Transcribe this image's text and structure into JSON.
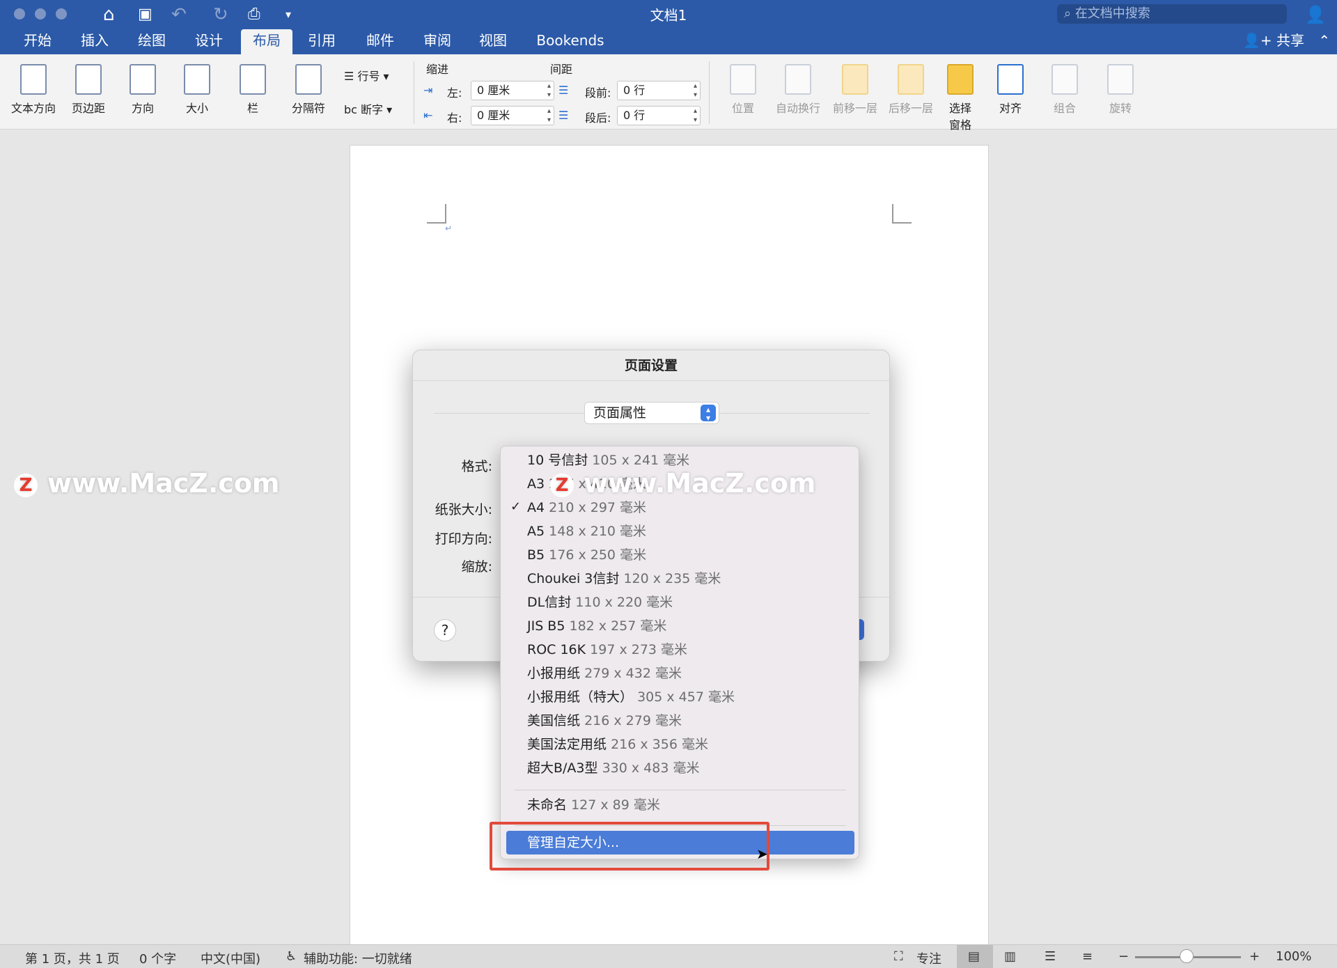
{
  "window": {
    "title": "文档1",
    "search_placeholder": "在文档中搜索"
  },
  "tabs": [
    "开始",
    "插入",
    "绘图",
    "设计",
    "布局",
    "引用",
    "邮件",
    "审阅",
    "视图",
    "Bookends"
  ],
  "active_tab": "布局",
  "share_label": "共享",
  "ribbon": {
    "text_direction": "文本方向",
    "margins": "页边距",
    "orientation": "方向",
    "size": "大小",
    "columns": "栏",
    "breaks": "分隔符",
    "line_numbers": "行号",
    "hyphenation": "断字",
    "indent_title": "缩进",
    "spacing_title": "间距",
    "left_label": "左:",
    "right_label": "右:",
    "before_label": "段前:",
    "after_label": "段后:",
    "indent_left": "0 厘米",
    "indent_right": "0 厘米",
    "space_before": "0 行",
    "space_after": "0 行",
    "position": "位置",
    "wrap_text": "自动换行",
    "bring_forward": "前移一层",
    "send_backward": "后移一层",
    "selection_pane": "选择窗格",
    "align": "对齐",
    "group": "组合",
    "rotate": "旋转"
  },
  "dialog": {
    "title": "页面设置",
    "settings_popup": "页面属性",
    "format_label": "格式:",
    "paper_size_label": "纸张大小:",
    "orientation_label": "打印方向:",
    "scale_label": "缩放:",
    "help": "?"
  },
  "paper_menu": {
    "items": [
      {
        "name": "10 号信封",
        "dims": "105 x 241 毫米"
      },
      {
        "name": "A3",
        "dims": "297 x 420 毫米"
      },
      {
        "name": "A4",
        "dims": "210 x 297 毫米",
        "checked": true
      },
      {
        "name": "A5",
        "dims": "148 x 210 毫米"
      },
      {
        "name": "B5",
        "dims": "176 x 250 毫米"
      },
      {
        "name": "Choukei 3信封",
        "dims": "120 x 235 毫米"
      },
      {
        "name": "DL信封",
        "dims": "110 x 220 毫米"
      },
      {
        "name": "JIS B5",
        "dims": "182 x 257 毫米"
      },
      {
        "name": "ROC 16K",
        "dims": "197 x 273 毫米"
      },
      {
        "name": "小报用纸",
        "dims": "279 x 432 毫米"
      },
      {
        "name": "小报用纸（特大）",
        "dims": "305 x 457 毫米"
      },
      {
        "name": "美国信纸",
        "dims": "216 x 279 毫米"
      },
      {
        "name": "美国法定用纸",
        "dims": "216 x 356 毫米"
      },
      {
        "name": "超大B/A3型",
        "dims": "330 x 483 毫米"
      }
    ],
    "custom": {
      "name": "未命名",
      "dims": "127 x 89 毫米"
    },
    "manage": "管理自定大小...",
    "check_mark": "✓"
  },
  "watermark": "www.MacZ.com",
  "watermark_logo": "Z",
  "status": {
    "page": "第 1 页，共 1 页",
    "words": "0 个字",
    "language": "中文(中国)",
    "accessibility": "辅助功能: 一切就绪",
    "focus": "专注",
    "zoom": "100%"
  },
  "colors": {
    "titlebar": "#2c5aa8",
    "highlight": "#4a7cd8",
    "annotation": "#e24a3b"
  }
}
